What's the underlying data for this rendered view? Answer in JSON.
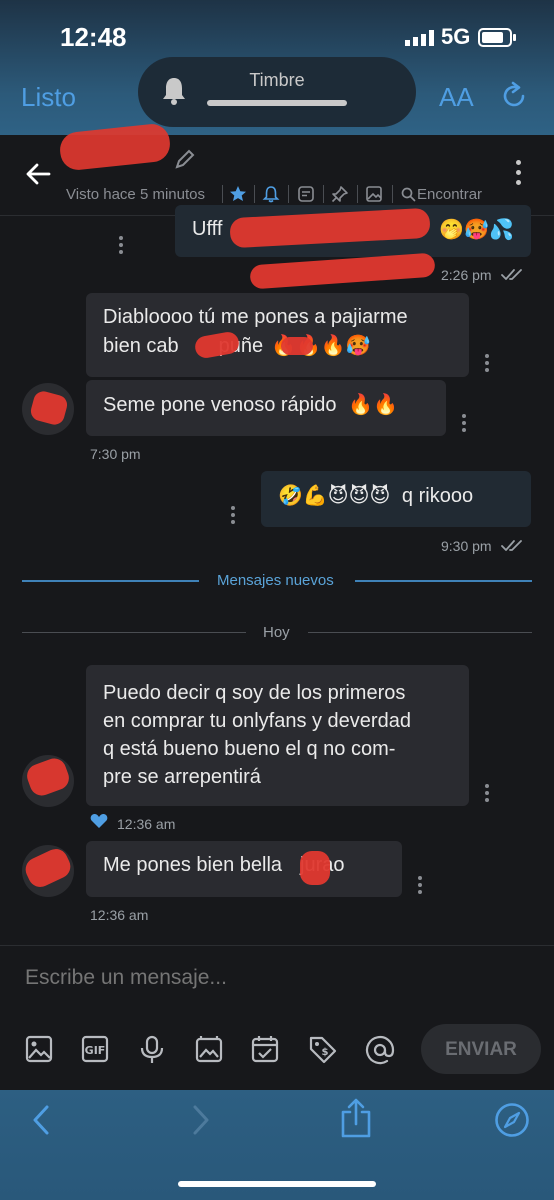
{
  "status_bar": {
    "time": "12:48",
    "network": "5G"
  },
  "browser": {
    "done_label": "Listo",
    "text_size_label": "AA",
    "pill_title": "Timbre"
  },
  "chat": {
    "seen": "Visto hace 5 minutos",
    "find_label": "Encontrar",
    "messages": [
      {
        "dir": "out",
        "text": "Ufff",
        "emoji": "🤭🥵💦"
      },
      {
        "dir": "out-ts",
        "time": "2:26 pm"
      },
      {
        "dir": "in",
        "line1": "Diabloooo tú me pones a pajiarme",
        "line2a": "bien cab",
        "line2b": "puñe",
        "emoji": "🔥🔥🔥🥵"
      },
      {
        "dir": "in",
        "text": "Seme pone venoso rápido",
        "emoji": "🔥🔥",
        "time": "7:30 pm"
      },
      {
        "dir": "out",
        "emoji": "🤣💪😈😈😈",
        "text": "q rikooo",
        "time": "9:30 pm"
      },
      {
        "dir": "in",
        "lines": [
          "Puedo decir q soy de los primeros",
          "en comprar tu onlyfans y deverdad",
          "q está bueno bueno el q no com-",
          "pre se arrepentirá"
        ],
        "time": "12:36 am"
      },
      {
        "dir": "in",
        "text_a": "Me pones bien bella",
        "text_b": "jurao",
        "time": "12:36 am"
      }
    ],
    "divider_new": "Mensajes nuevos",
    "divider_day": "Hoy"
  },
  "composer": {
    "placeholder": "Escribe un mensaje...",
    "send_label": "ENVIAR"
  },
  "colors": {
    "accent": "#4f9ee3",
    "bubble_in": "#2a2b30",
    "bubble_out": "#212a33",
    "redaction": "#e0382f"
  }
}
